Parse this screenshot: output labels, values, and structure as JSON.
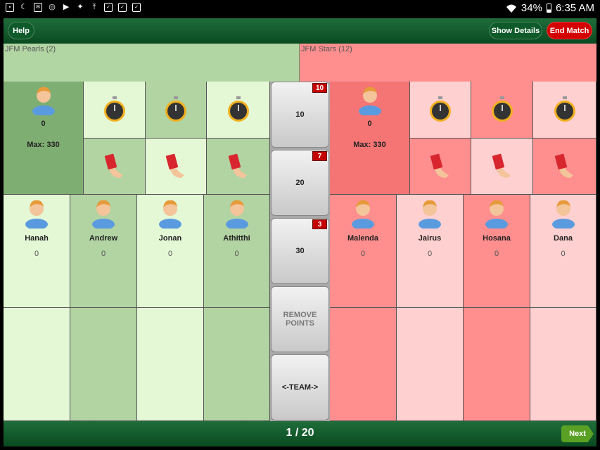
{
  "status_bar": {
    "battery": "34%",
    "time": "6:35 AM"
  },
  "toolbar": {
    "help_label": "Help",
    "details_label": "Show Details",
    "end_label": "End Match"
  },
  "team_left": {
    "name": "JFM Pearls (2)",
    "score": "0",
    "max": "Max: 330",
    "players": [
      {
        "name": "Hanah",
        "score": "0"
      },
      {
        "name": "Andrew",
        "score": "0"
      },
      {
        "name": "Jonan",
        "score": "0"
      },
      {
        "name": "Athitthi",
        "score": "0"
      }
    ]
  },
  "team_right": {
    "name": "JFM Stars (12)",
    "score": "0",
    "max": "Max: 330",
    "players": [
      {
        "name": "Malenda",
        "score": "0"
      },
      {
        "name": "Jairus",
        "score": "0"
      },
      {
        "name": "Hosana",
        "score": "0"
      },
      {
        "name": "Dana",
        "score": "0"
      }
    ]
  },
  "points": [
    {
      "label": "10",
      "badge": "10"
    },
    {
      "label": "20",
      "badge": "7"
    },
    {
      "label": "30",
      "badge": "3"
    }
  ],
  "remove_points_label": "REMOVE POINTS",
  "team_toggle_label": "<-TEAM->",
  "pager": "1 / 20",
  "next_label": "Next",
  "colors": {
    "toolbar_green": "#0f5a2a",
    "end_red": "#d40000",
    "badge_red": "#c40000",
    "next_green": "#5aa024"
  }
}
